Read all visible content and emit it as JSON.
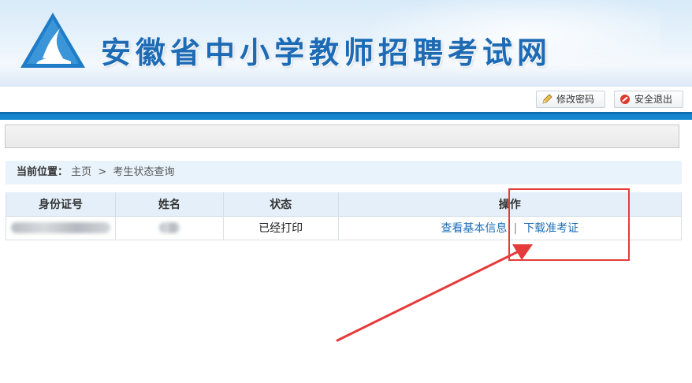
{
  "header": {
    "site_title": "安徽省中小学教师招聘考试网",
    "logo_icon": "sail-triangle-logo"
  },
  "toolbar": {
    "change_password_label": "修改密码",
    "logout_label": "安全退出"
  },
  "breadcrumb": {
    "prefix": "当前位置：",
    "home": "主页",
    "separator": ">",
    "current": "考生状态查询"
  },
  "table": {
    "headers": [
      "身份证号",
      "姓名",
      "状态",
      "操作"
    ],
    "rows": [
      {
        "id_number": "",
        "name": "",
        "status": "已经打印",
        "actions": [
          "查看基本信息",
          "下载准考证"
        ],
        "action_separator": "|"
      }
    ]
  },
  "colors": {
    "brand_blue": "#1486cf",
    "title_blue": "#1d6bb5",
    "link_blue": "#1e6fb8",
    "annotation_red": "#e53b3b"
  }
}
